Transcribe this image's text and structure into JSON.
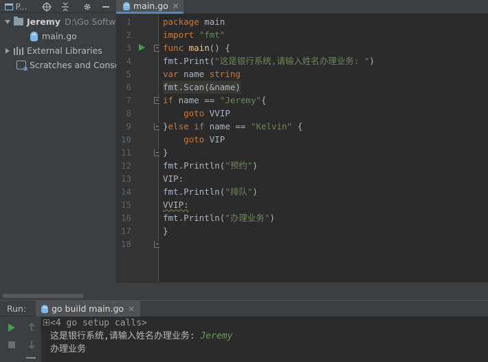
{
  "project_toolbar": {
    "view_label": "P..."
  },
  "project_tree": {
    "root": {
      "name": "Jeremy",
      "path": "D:\\Go Softwa"
    },
    "file": "main.go",
    "external_libraries": "External Libraries",
    "scratches": "Scratches and Consol"
  },
  "editor": {
    "tab_label": "main.go",
    "line_numbers": [
      "1",
      "2",
      "3",
      "4",
      "5",
      "6",
      "7",
      "8",
      "9",
      "10",
      "11",
      "12",
      "13",
      "14",
      "15",
      "16",
      "17",
      "18"
    ],
    "code": {
      "l1_kw": "package",
      "l1_rest": " main",
      "l2_kw": "import",
      "l2_str": " \"fmt\"",
      "l3_kw": "func",
      "l3_fn": " main",
      "l3_rest": "() {",
      "l4_pre": "fmt.Print(",
      "l4_str": "\"这是银行系统,请输入姓名办理业务: \"",
      "l4_post": ")",
      "l5_kw": "var",
      "l5_rest": " name ",
      "l5_type": "string",
      "l6": "fmt.Scan(&name)",
      "l7_kw": "if",
      "l7_rest": " name == ",
      "l7_str": "\"Jeremy\"",
      "l7_post": "{",
      "l8_kw": "    goto",
      "l8_rest": " VVIP",
      "l9_pre": "}",
      "l9_kw1": "else",
      "l9_kw2": " if",
      "l9_rest": " name == ",
      "l9_str": "\"Kelvin\"",
      "l9_post": " {",
      "l10_kw": "    goto",
      "l10_rest": " VIP",
      "l11": "}",
      "l12_pre": "fmt.Println(",
      "l12_str": "\"预约\"",
      "l12_post": ")",
      "l13": "VIP:",
      "l14_pre": "fmt.Println(",
      "l14_str": "\"排队\"",
      "l14_post": ")",
      "l15": "VVIP:",
      "l16_pre": "fmt.Println(",
      "l16_str": "\"办理业务\"",
      "l16_post": ")",
      "l17": "}",
      "l18": ""
    }
  },
  "run_panel": {
    "label": "Run:",
    "tab_label": "go build main.go",
    "output": {
      "setup_calls": "<4 go setup calls>",
      "prompt": "这是银行系统,请输入姓名办理业务: ",
      "user_input": "Jeremy",
      "result": "办理业务"
    }
  },
  "colors": {
    "keyword": "#cc7832",
    "string": "#6a8759",
    "function": "#ffc66d",
    "user_input": "#5fa24d",
    "accent": "#4a88c7"
  }
}
